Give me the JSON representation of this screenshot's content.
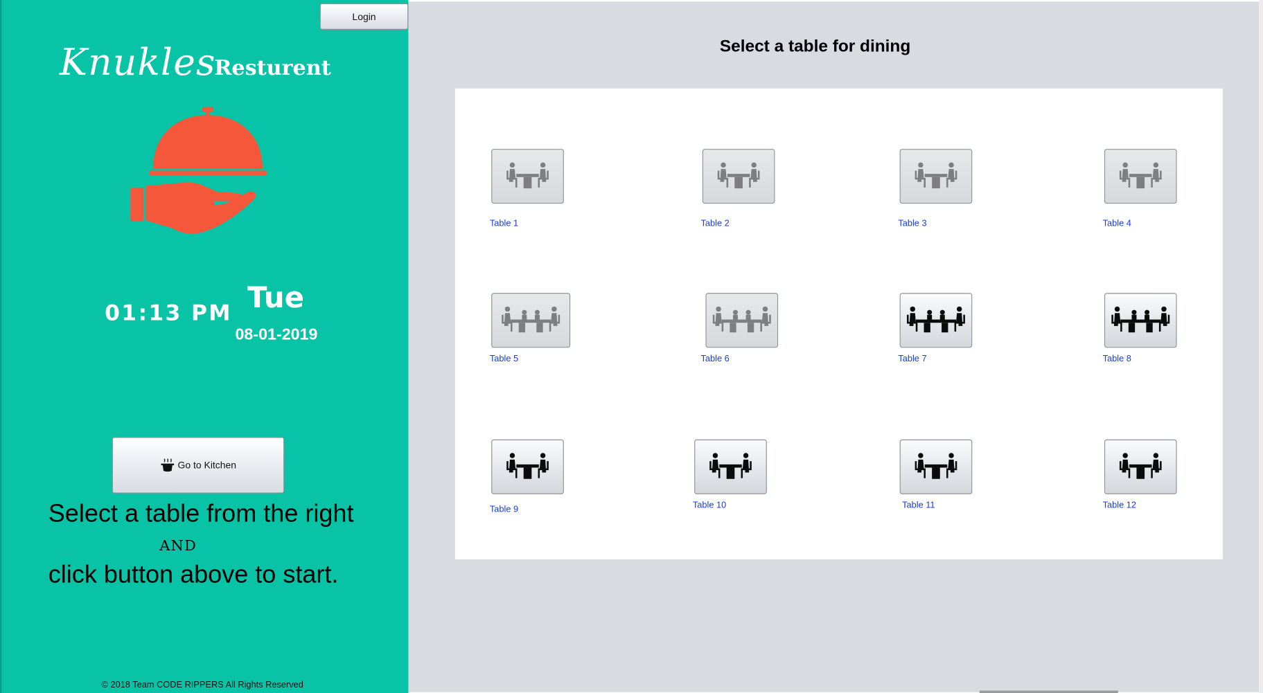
{
  "window": {
    "accent": "#09c3a6",
    "logo_color": "#f4573a",
    "link_color": "#1a3dd4"
  },
  "sidebar": {
    "login_label": "Login",
    "brand_script": "Knukles",
    "brand_word": "Resturent",
    "logo_icon": "cloche-on-hand-icon",
    "time": "01:13 PM",
    "day": "Tue",
    "date": "08-01-2019",
    "kitchen_icon": "cooking-pot-icon",
    "kitchen_label": "Go to Kitchen",
    "instruction_line1": "Select a table from the right",
    "instruction_and": "AND",
    "instruction_line2": "click button above to start.",
    "footer": "© 2018 Team CODE RIPPERS All Rights Reserved"
  },
  "main": {
    "title": "Select a table for dining",
    "tables": [
      {
        "label": "Table 1",
        "seats": 2,
        "state": "occupied"
      },
      {
        "label": "Table 2",
        "seats": 2,
        "state": "occupied"
      },
      {
        "label": "Table 3",
        "seats": 2,
        "state": "occupied"
      },
      {
        "label": "Table 4",
        "seats": 2,
        "state": "occupied"
      },
      {
        "label": "Table 5",
        "seats": 4,
        "state": "occupied"
      },
      {
        "label": "Table 6",
        "seats": 4,
        "state": "occupied"
      },
      {
        "label": "Table 7",
        "seats": 4,
        "state": "available"
      },
      {
        "label": "Table 8",
        "seats": 4,
        "state": "available"
      },
      {
        "label": "Table 9",
        "seats": 2,
        "state": "available"
      },
      {
        "label": "Table 10",
        "seats": 2,
        "state": "available"
      },
      {
        "label": "Table 11",
        "seats": 2,
        "state": "available"
      },
      {
        "label": "Table 12",
        "seats": 2,
        "state": "available"
      }
    ]
  }
}
